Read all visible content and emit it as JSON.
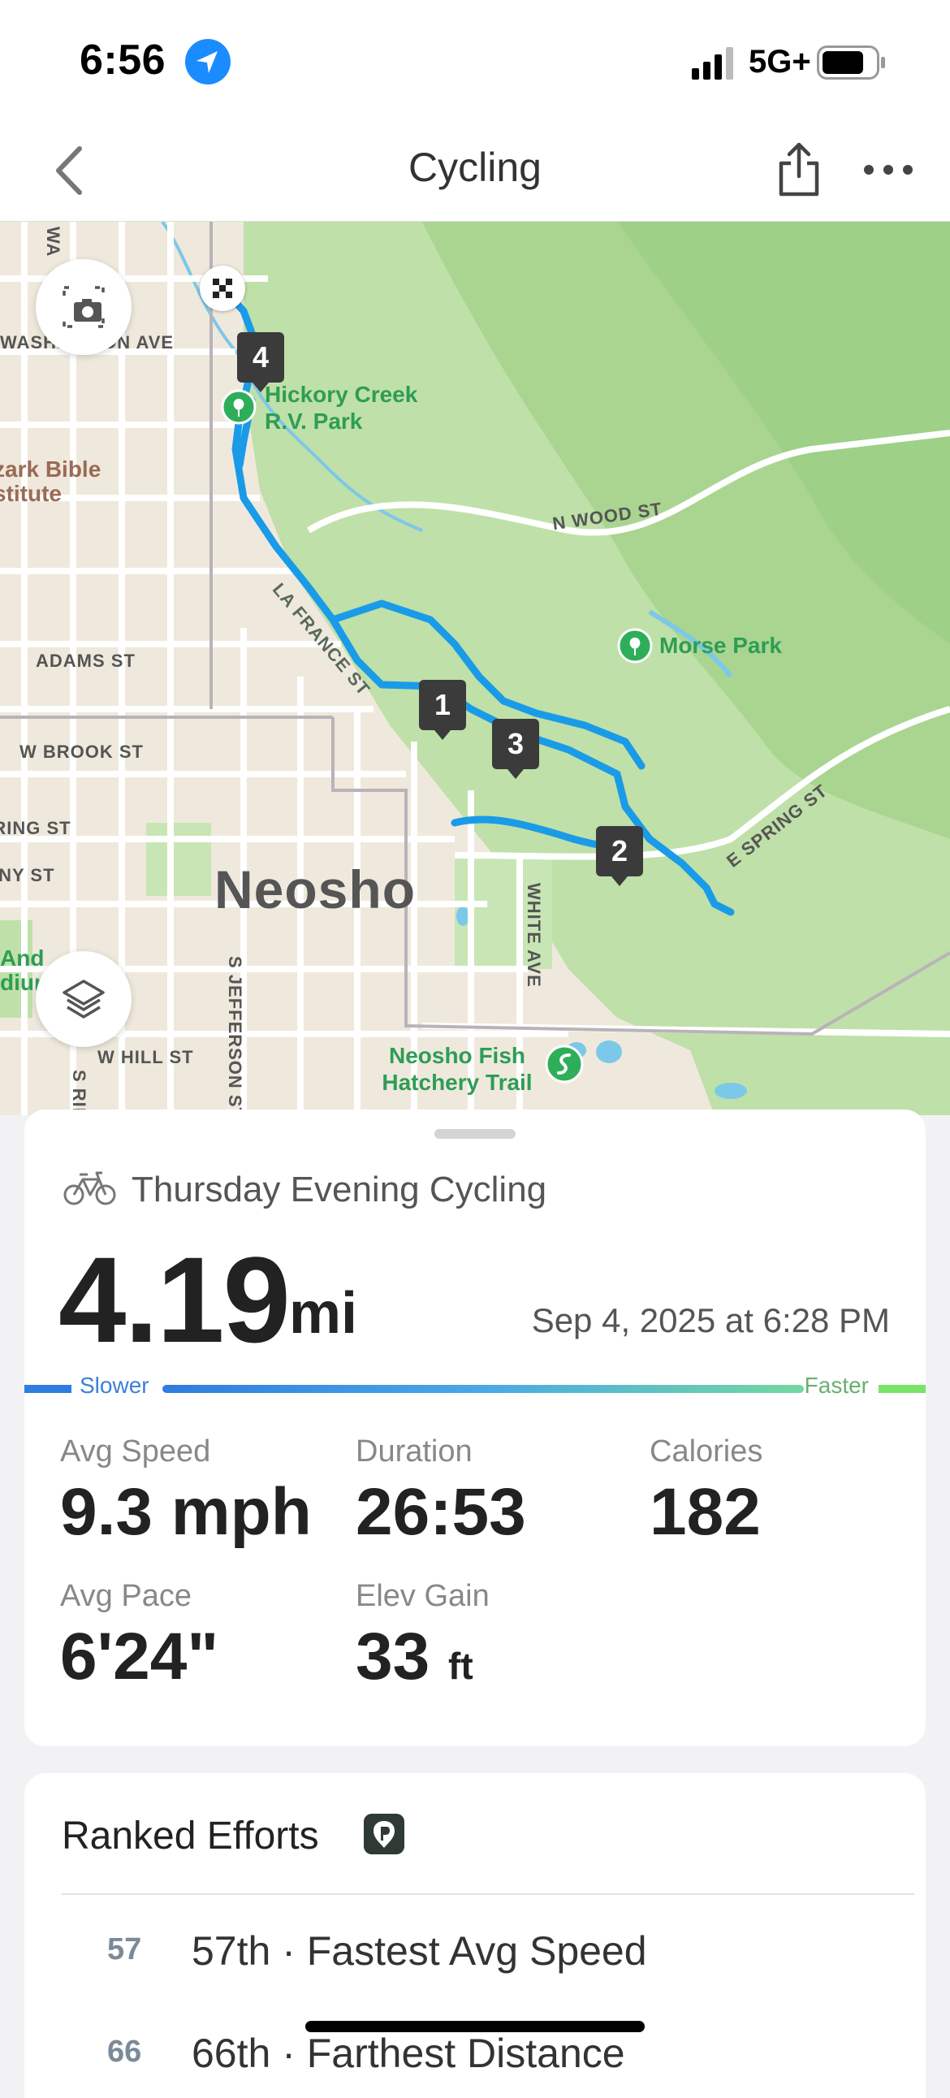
{
  "status_bar": {
    "time": "6:56",
    "network": "5G+",
    "icons": [
      "location-arrow-icon",
      "signal-bars-icon",
      "battery-icon"
    ]
  },
  "nav": {
    "title": "Cycling",
    "icons": [
      "back-chevron-icon",
      "share-icon",
      "more-icon"
    ]
  },
  "map": {
    "city": "Neosho",
    "streets": [
      "WASHINGTON AVE",
      "N WOOD ST",
      "LA FRANCE ST",
      "ADAMS ST",
      "W BROOK ST",
      "SPRING ST",
      "TONY ST",
      "WHITE AVE",
      "S JEFFERSON ST",
      "W HILL ST",
      "S RIDGE ST",
      "E SPRING ST",
      "WA"
    ],
    "pois": [
      "Hickory Creek R.V. Park",
      "Morse Park",
      "Neosho Fish Hatchery Trail"
    ],
    "other_labels": [
      "zark Bible stitute",
      "And dium"
    ],
    "lap_markers": [
      "1",
      "2",
      "3",
      "4"
    ],
    "route_color": "#1a9be8",
    "buttons": [
      "screenshot-camera-icon",
      "map-layers-icon"
    ]
  },
  "summary": {
    "activity_type_icon": "bicycle-icon",
    "activity_title": "Thursday Evening Cycling",
    "distance": "4.19",
    "distance_unit": "mi",
    "date": "Sep 4, 2025 at 6:28 PM",
    "legend_slower": "Slower",
    "legend_faster": "Faster",
    "stats": {
      "avg_speed": {
        "label": "Avg Speed",
        "value": "9.3 mph"
      },
      "duration": {
        "label": "Duration",
        "value": "26:53"
      },
      "calories": {
        "label": "Calories",
        "value": "182"
      },
      "avg_pace": {
        "label": "Avg Pace",
        "value": "6'24\""
      },
      "elev_gain": {
        "label": "Elev Gain",
        "value": "33",
        "unit": "ft"
      }
    }
  },
  "ranked": {
    "title": "Ranked Efforts",
    "badge_icon": "ranked-badge-icon",
    "rows": [
      {
        "rank": "57",
        "text": "57th · Fastest Avg Speed"
      },
      {
        "rank": "66",
        "text": "66th · Farthest Distance"
      }
    ]
  }
}
